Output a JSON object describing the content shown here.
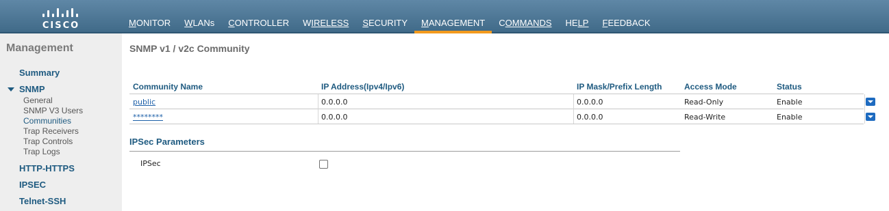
{
  "brand": {
    "name": "CISCO"
  },
  "nav": {
    "items": [
      {
        "first": "M",
        "rest": "ONITOR"
      },
      {
        "first": "W",
        "rest": "LANs"
      },
      {
        "first": "C",
        "rest": "ONTROLLER"
      },
      {
        "first": "W",
        "rest": "IRELESS"
      },
      {
        "first": "S",
        "rest": "ECURITY"
      },
      {
        "first": "M",
        "rest": "ANAGEMENT"
      },
      {
        "first": "C",
        "rest": "OMMANDS"
      },
      {
        "first": "HE",
        "rest": "LP",
        "underline_part": "rest"
      },
      {
        "first": "F",
        "rest": "EEDBACK"
      }
    ],
    "active": "MANAGEMENT",
    "accent_color": "#f39a1e"
  },
  "sidebar": {
    "title": "Management",
    "summary": "Summary",
    "snmp": "SNMP",
    "snmp_children": [
      "General",
      "SNMP V3 Users",
      "Communities",
      "Trap Receivers",
      "Trap Controls",
      "Trap Logs"
    ],
    "active_child": "Communities",
    "http_https": "HTTP-HTTPS",
    "ipsec": "IPSEC",
    "telnet_ssh": "Telnet-SSH"
  },
  "main": {
    "title": "SNMP v1 / v2c Community",
    "table": {
      "headers": [
        "Community Name",
        "IP Address(Ipv4/Ipv6)",
        "IP Mask/Prefix Length",
        "Access Mode",
        "Status"
      ],
      "rows": [
        {
          "name": "public",
          "ip": "0.0.0.0",
          "mask": "0.0.0.0",
          "mode": "Read-Only",
          "status": "Enable"
        },
        {
          "name": "********",
          "ip": "0.0.0.0",
          "mask": "0.0.0.0",
          "mode": "Read-Write",
          "status": "Enable"
        }
      ]
    },
    "ipsec_section": {
      "title": "IPSec Parameters",
      "label": "IPSec",
      "checked": false
    }
  }
}
